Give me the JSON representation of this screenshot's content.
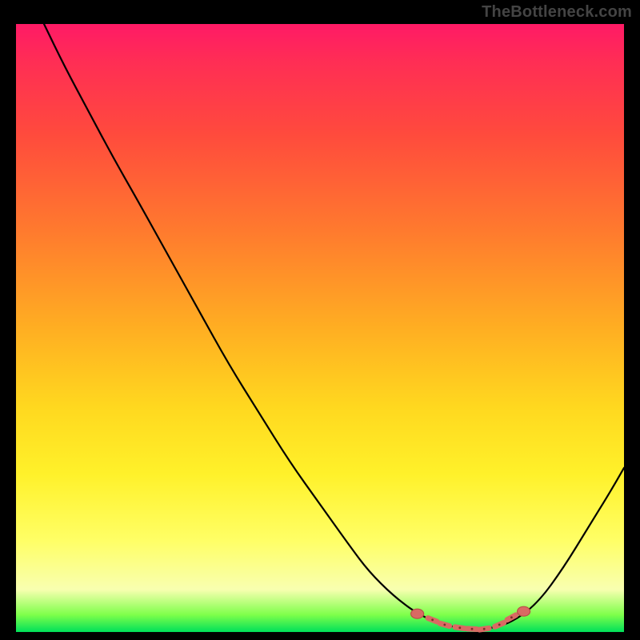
{
  "watermark": "TheBottleneck.com",
  "chart_data": {
    "type": "line",
    "title": "",
    "xlabel": "",
    "ylabel": "",
    "xlim": [
      0,
      100
    ],
    "ylim": [
      0,
      100
    ],
    "grid": false,
    "legend": false,
    "gradient_background": {
      "orientation": "vertical",
      "stops": [
        {
          "pos": 0.0,
          "color": "#ff1a66"
        },
        {
          "pos": 0.06,
          "color": "#ff2d55"
        },
        {
          "pos": 0.18,
          "color": "#ff4a3d"
        },
        {
          "pos": 0.34,
          "color": "#ff7a2e"
        },
        {
          "pos": 0.5,
          "color": "#ffae22"
        },
        {
          "pos": 0.63,
          "color": "#ffd81f"
        },
        {
          "pos": 0.74,
          "color": "#fff12a"
        },
        {
          "pos": 0.85,
          "color": "#ffff66"
        },
        {
          "pos": 0.93,
          "color": "#f8ffb0"
        },
        {
          "pos": 0.972,
          "color": "#7dff4a"
        },
        {
          "pos": 1.0,
          "color": "#00e05a"
        }
      ]
    },
    "series": [
      {
        "name": "bottleneck-curve",
        "color": "#000000",
        "x": [
          4.6,
          8,
          12,
          16,
          20,
          25,
          30,
          35,
          40,
          45,
          50,
          55,
          58,
          62,
          66,
          70,
          74,
          78,
          82,
          86,
          90,
          94,
          98,
          100
        ],
        "y": [
          100,
          93,
          85.5,
          78,
          71,
          62,
          53,
          44,
          36,
          28,
          21,
          14,
          10,
          6,
          3,
          1.2,
          0.5,
          0.5,
          1.8,
          5,
          10.5,
          17,
          23.5,
          27
        ]
      }
    ],
    "markers": {
      "name": "highlight-dots",
      "color": "#d96a63",
      "points": [
        {
          "x": 66,
          "y": 3
        },
        {
          "x": 68.5,
          "y": 2
        },
        {
          "x": 70.5,
          "y": 1.2
        },
        {
          "x": 73,
          "y": 0.7
        },
        {
          "x": 75,
          "y": 0.5
        },
        {
          "x": 77,
          "y": 0.5
        },
        {
          "x": 79.5,
          "y": 1.2
        },
        {
          "x": 81.5,
          "y": 2.4
        },
        {
          "x": 83.5,
          "y": 3.4
        }
      ]
    },
    "annotations": []
  }
}
